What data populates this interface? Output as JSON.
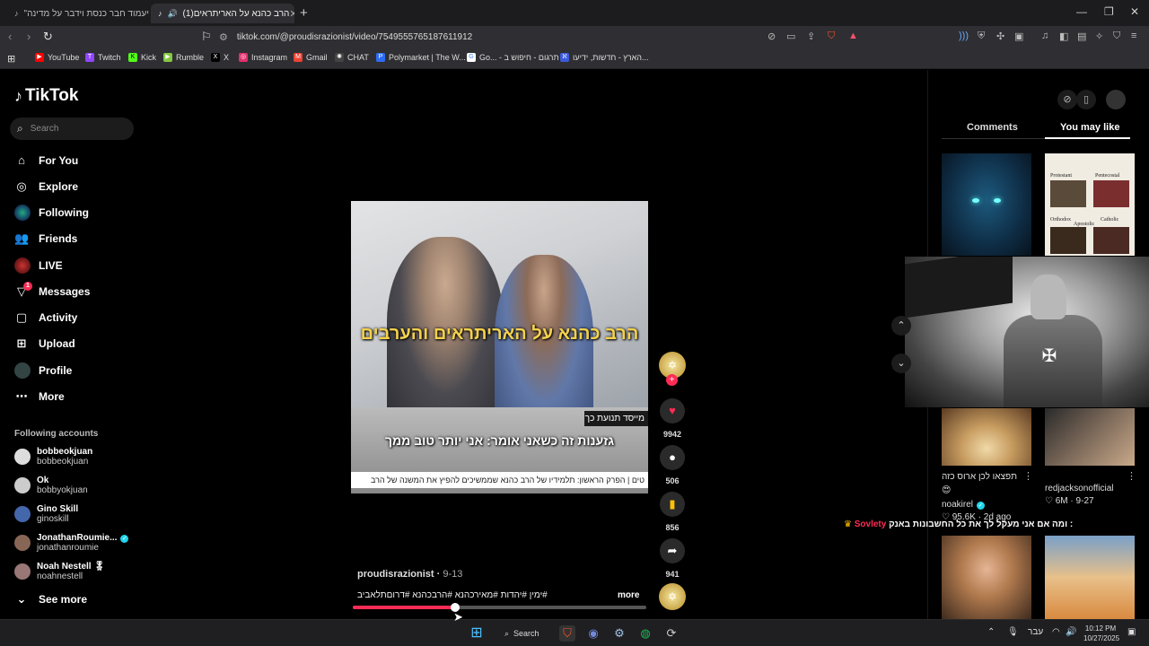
{
  "browser": {
    "tabs": [
      {
        "label": "\"לא יעמוד חבר כנסת וידבר על מדינה",
        "icon": "tiktok-icon",
        "active": false
      },
      {
        "label": "(1)הרב כהנא על האריתראים",
        "icon": "tiktok-icon",
        "active": true
      }
    ],
    "url": "tiktok.com/@proudisrazionist/video/7549555765187611912",
    "bookmarks": [
      {
        "label": "YouTube",
        "color": "#ff0000",
        "icon": "▶"
      },
      {
        "label": "Twitch",
        "color": "#9146ff",
        "icon": "T"
      },
      {
        "label": "Kick",
        "color": "#53fc18",
        "icon": "K"
      },
      {
        "label": "Rumble",
        "color": "#85c742",
        "icon": "▶"
      },
      {
        "label": "X",
        "color": "#000000",
        "icon": "X"
      },
      {
        "label": "Instagram",
        "color": "#e1306c",
        "icon": "◎"
      },
      {
        "label": "Gmail",
        "color": "#ea4335",
        "icon": "M"
      },
      {
        "label": "CHAT",
        "color": "#444444",
        "icon": "✺"
      },
      {
        "label": "Polymarket | The W...",
        "color": "#2d6cf5",
        "icon": "P"
      },
      {
        "label": "Go... - תרגום - חיפוש ב",
        "color": "#ffffff",
        "icon": "G"
      },
      {
        "label": "הארץ - חדשות, ידיעו...",
        "color": "#3b5bdb",
        "icon": "ℵ"
      }
    ]
  },
  "tiktok": {
    "logo": "TikTok",
    "search_placeholder": "Search",
    "nav": [
      {
        "label": "For You",
        "icon": "home-icon"
      },
      {
        "label": "Explore",
        "icon": "compass-icon"
      },
      {
        "label": "Following",
        "icon": "following-icon"
      },
      {
        "label": "Friends",
        "icon": "friends-icon"
      },
      {
        "label": "LIVE",
        "icon": "live-icon"
      },
      {
        "label": "Messages",
        "icon": "messages-icon",
        "badge": "1"
      },
      {
        "label": "Activity",
        "icon": "activity-icon"
      },
      {
        "label": "Upload",
        "icon": "upload-icon"
      },
      {
        "label": "Profile",
        "icon": "profile-icon"
      },
      {
        "label": "More",
        "icon": "more-icon"
      }
    ],
    "following_heading": "Following accounts",
    "following": [
      {
        "name": "bobbeokjuan",
        "handle": "bobbeokjuan",
        "verified": false
      },
      {
        "name": "Ok",
        "handle": "bobbyokjuan",
        "verified": false
      },
      {
        "name": "Gino Skill",
        "handle": "ginoskill",
        "verified": false
      },
      {
        "name": "JonathanRoumie...",
        "handle": "jonathanroumie",
        "verified": true
      },
      {
        "name": "Noah Nestell",
        "handle": "noahnestell",
        "verified": false,
        "suffix": "🎖"
      }
    ],
    "see_more": "See more"
  },
  "video": {
    "caption_main": "הרב כהנא על האריתראים והערבים",
    "caption_tag": "מייסד תנועת כך",
    "caption_sub": "גזענות זה כשאני אומר: אני יותר טוב ממך",
    "ticker": "טים | הפרק הראשון: תלמידיו של הרב כהנא שממשיכים להפיץ את המשנה של הרב",
    "author": "proudisrazionist",
    "date": "9-13",
    "description": "#ימין #יהדות #מאירכהנא #הרבכהנא #דרוםתלאביב",
    "more": "more",
    "progress": 0.35,
    "actions": [
      {
        "name": "like",
        "count": "9942",
        "icon": "♥",
        "color": "#fe2c55"
      },
      {
        "name": "comment",
        "count": "506",
        "icon": "●",
        "color": "#ffffff"
      },
      {
        "name": "save",
        "count": "856",
        "icon": "▮",
        "color": "#ffc107"
      },
      {
        "name": "share",
        "count": "941",
        "icon": "➦",
        "color": "#ffffff"
      }
    ]
  },
  "right_panel": {
    "tab_comments": "Comments",
    "tab_you_may_like": "You may like",
    "chart_labels": [
      "Protestant",
      "Pentecostal",
      "Orthodox",
      "Catholic",
      "Apostolic"
    ],
    "cards": [
      {
        "title": "תפצאו לכן ארוס כזה",
        "emoji": "😍",
        "author": "noakirel",
        "verified": true,
        "likes": "95.6K",
        "age": "2d ago"
      },
      {
        "title": "redjacksonofficial",
        "likes": "6M",
        "date": "9-27"
      }
    ],
    "live_comment_user": "Sovlety",
    "live_comment_text": "ומה אם אני מעקל לך את כל החשבונות באנק :"
  },
  "taskbar": {
    "search": "Search",
    "lang": "עבר",
    "time": "10:12 PM",
    "date": "10/27/2025"
  }
}
